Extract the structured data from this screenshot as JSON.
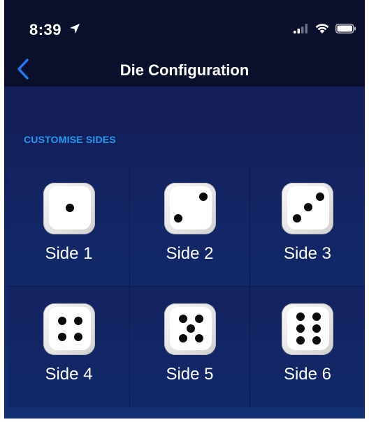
{
  "status_bar": {
    "time": "8:39",
    "location_icon": "location-arrow-icon",
    "signal_icon": "cellular-signal-icon",
    "wifi_icon": "wifi-icon",
    "battery_icon": "battery-icon"
  },
  "nav": {
    "back_icon": "chevron-left-icon",
    "title": "Die Configuration"
  },
  "section": {
    "header": "CUSTOMISE SIDES"
  },
  "sides": [
    {
      "label": "Side 1",
      "pips": 1
    },
    {
      "label": "Side 2",
      "pips": 2
    },
    {
      "label": "Side 3",
      "pips": 3
    },
    {
      "label": "Side 4",
      "pips": 4
    },
    {
      "label": "Side 5",
      "pips": 5
    },
    {
      "label": "Side 6",
      "pips": 6
    }
  ],
  "colors": {
    "accent": "#1e9bf3",
    "back_chevron": "#1f7bf6",
    "background_top": "#151d55",
    "background_bottom": "#123171",
    "status_bar": "#0a0f2b",
    "label_text": "#ffffff"
  }
}
